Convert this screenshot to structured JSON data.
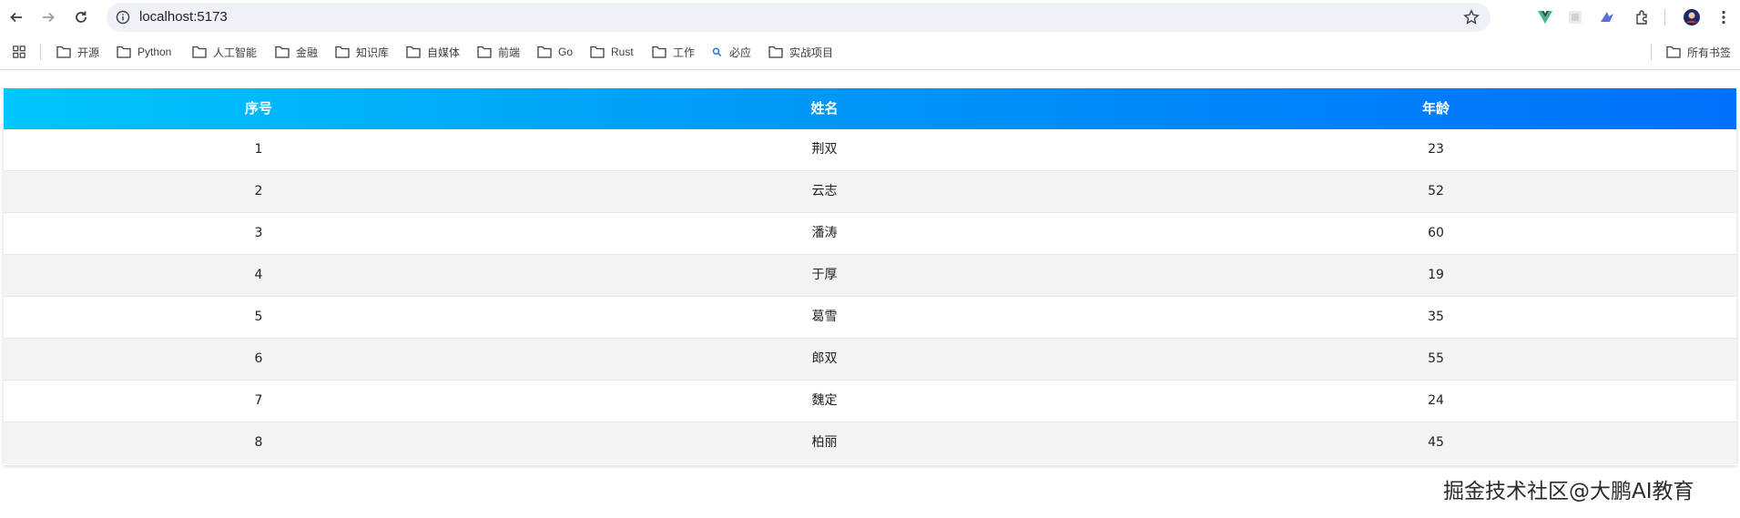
{
  "browser": {
    "url": "localhost:5173",
    "icons": {
      "back": "arrow-left-icon",
      "forward": "arrow-right-icon",
      "reload": "reload-icon",
      "info": "info-icon",
      "star": "star-icon",
      "vue_devtools": "vue-icon",
      "extensions": "puzzle-icon",
      "menu": "kebab-icon"
    }
  },
  "bookmarks": {
    "items": [
      "开源",
      "Python",
      "人工智能",
      "金融",
      "知识库",
      "自媒体",
      "前端",
      "Go",
      "Rust",
      "工作",
      "必应",
      "实战项目"
    ],
    "all_bookmarks": "所有书签"
  },
  "table": {
    "headers": [
      "序号",
      "姓名",
      "年龄"
    ],
    "header_gradient": [
      "#00c6fb",
      "#0070fc"
    ],
    "rows": [
      {
        "index": "1",
        "name": "荆双",
        "age": "23"
      },
      {
        "index": "2",
        "name": "云志",
        "age": "52"
      },
      {
        "index": "3",
        "name": "潘涛",
        "age": "60"
      },
      {
        "index": "4",
        "name": "于厚",
        "age": "19"
      },
      {
        "index": "5",
        "name": "葛雪",
        "age": "35"
      },
      {
        "index": "6",
        "name": "郎双",
        "age": "55"
      },
      {
        "index": "7",
        "name": "魏定",
        "age": "24"
      },
      {
        "index": "8",
        "name": "柏丽",
        "age": "45"
      }
    ]
  },
  "watermark": "掘金技术社区@大鹏AI教育"
}
